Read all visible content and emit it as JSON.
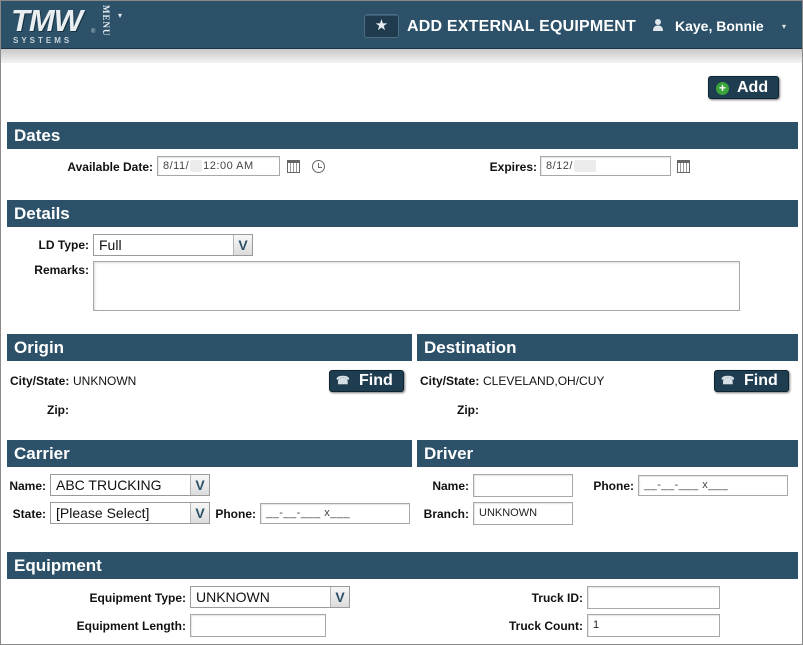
{
  "header": {
    "logo": "TMW",
    "logo_sub": "SYSTEMS",
    "logo_reg": "®",
    "menu_label": "MENU",
    "menu_caret": "▾",
    "favorite_icon": "★",
    "title": "ADD EXTERNAL EQUIPMENT",
    "user_name": "Kaye, Bonnie",
    "user_caret": "▾"
  },
  "toolbar": {
    "add_label": "Add",
    "add_icon": "+"
  },
  "dates": {
    "title": "Dates",
    "available_label": "Available Date:",
    "available_value_a": "8/11/",
    "available_value_b": "12:00 AM",
    "expires_label": "Expires:",
    "expires_value": "8/12/"
  },
  "details": {
    "title": "Details",
    "ld_type_label": "LD Type:",
    "ld_type_value": "Full",
    "remarks_label": "Remarks:"
  },
  "origin": {
    "title": "Origin",
    "city_state_label": "City/State:",
    "city_state_value": "UNKNOWN",
    "zip_label": "Zip:",
    "find_label": "Find"
  },
  "destination": {
    "title": "Destination",
    "city_state_label": "City/State:",
    "city_state_value": "CLEVELAND,OH/CUY",
    "zip_label": "Zip:",
    "find_label": "Find"
  },
  "carrier": {
    "title": "Carrier",
    "name_label": "Name:",
    "name_value": "ABC TRUCKING",
    "state_label": "State:",
    "state_value": "[Please Select]",
    "phone_label": "Phone:",
    "phone_value": "__-__-___ x___"
  },
  "driver": {
    "title": "Driver",
    "name_label": "Name:",
    "phone_label": "Phone:",
    "phone_value": "__-__-___ x___",
    "branch_label": "Branch:",
    "branch_value": "UNKNOWN"
  },
  "equipment": {
    "title": "Equipment",
    "type_label": "Equipment Type:",
    "type_value": "UNKNOWN",
    "length_label": "Equipment Length:",
    "truck_id_label": "Truck ID:",
    "truck_count_label": "Truck Count:",
    "truck_count_value": "1"
  },
  "select_arrow": "V"
}
